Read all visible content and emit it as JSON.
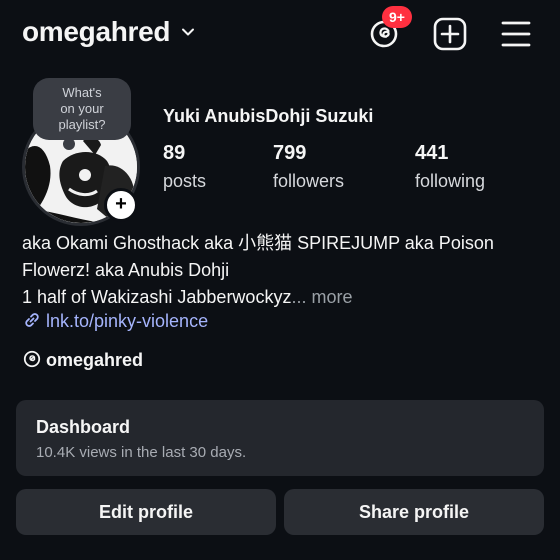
{
  "header": {
    "username": "omegahred",
    "notification_badge": "9+",
    "icons": [
      "chevron-down-icon",
      "threads-icon",
      "add-icon",
      "menu-icon"
    ]
  },
  "profile": {
    "note_bubble": [
      "What's",
      "on your",
      "playlist?"
    ],
    "display_name": "Yuki AnubisDohji Suzuki",
    "stats": [
      {
        "value": "89",
        "label": "posts"
      },
      {
        "value": "799",
        "label": "followers"
      },
      {
        "value": "441",
        "label": "following"
      }
    ]
  },
  "bio": {
    "line1": "aka Okami Ghosthack aka 小熊猫 SPIREJUMP aka Poison",
    "line2": "Flowerz! aka Anubis Dohji",
    "line3": "1 half of Wakizashi Jabberwockyz",
    "ellipsis": "...",
    "more": " more",
    "link": "lnk.to/pinky-violence",
    "threads_handle": "omegahred"
  },
  "dashboard": {
    "title": "Dashboard",
    "subtitle": "10.4K views in the last 30 days."
  },
  "buttons": {
    "edit": "Edit profile",
    "share": "Share profile"
  },
  "colors": {
    "background": "#0c0f14",
    "badge": "#ff3040",
    "link": "#a5b4fc",
    "card": "#24272d"
  }
}
